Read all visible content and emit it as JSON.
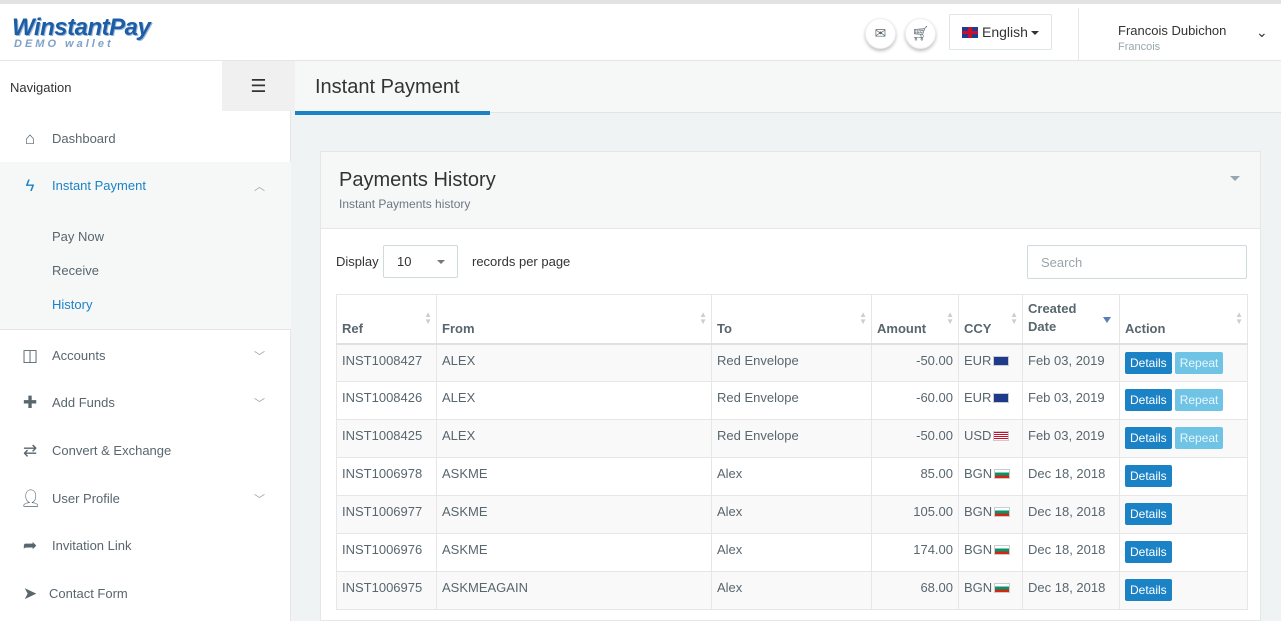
{
  "header": {
    "logo_main": "WinstantPay",
    "logo_sub": "DEMO wallet",
    "mail_icon": "envelope-icon",
    "cart_icon": "cart-icon",
    "language": "English",
    "user_name": "Francois Dubichon",
    "user_sub": "Francois"
  },
  "sidebar": {
    "heading": "Navigation",
    "items": [
      {
        "label": "Dashboard",
        "icon": "home-icon"
      },
      {
        "label": "Instant Payment",
        "icon": "bolt-icon"
      },
      {
        "label": "Accounts",
        "icon": "columns-icon"
      },
      {
        "label": "Add Funds",
        "icon": "plus-icon"
      },
      {
        "label": "Convert & Exchange",
        "icon": "exchange-icon"
      },
      {
        "label": "User Profile",
        "icon": "user-icon"
      },
      {
        "label": "Invitation Link",
        "icon": "share-icon"
      },
      {
        "label": "Contact Form",
        "icon": "paper-plane-icon"
      }
    ],
    "sub_items": [
      "Pay Now",
      "Receive",
      "History"
    ]
  },
  "page": {
    "title": "Instant Payment"
  },
  "panel": {
    "title": "Payments History",
    "subtitle": "Instant Payments history",
    "display_label": "Display",
    "display_value": "10",
    "records_label": "records per page",
    "search_placeholder": "Search"
  },
  "table": {
    "headers": [
      "Ref",
      "From",
      "To",
      "Amount",
      "CCY",
      "Created Date",
      "Action"
    ],
    "details_label": "Details",
    "repeat_label": "Repeat",
    "rows": [
      {
        "ref": "INST1008427",
        "from": "ALEX",
        "to": "Red Envelope",
        "amount": "-50.00",
        "ccy": "EUR",
        "date": "Feb 03, 2019"
      },
      {
        "ref": "INST1008426",
        "from": "ALEX",
        "to": "Red Envelope",
        "amount": "-60.00",
        "ccy": "EUR",
        "date": "Feb 03, 2019"
      },
      {
        "ref": "INST1008425",
        "from": "ALEX",
        "to": "Red Envelope",
        "amount": "-50.00",
        "ccy": "USD",
        "date": "Feb 03, 2019"
      },
      {
        "ref": "INST1006978",
        "from": "ASKME",
        "to": "Alex",
        "amount": "85.00",
        "ccy": "BGN",
        "date": "Dec 18, 2018"
      },
      {
        "ref": "INST1006977",
        "from": "ASKME",
        "to": "Alex",
        "amount": "105.00",
        "ccy": "BGN",
        "date": "Dec 18, 2018"
      },
      {
        "ref": "INST1006976",
        "from": "ASKME",
        "to": "Alex",
        "amount": "174.00",
        "ccy": "BGN",
        "date": "Dec 18, 2018"
      },
      {
        "ref": "INST1006975",
        "from": "ASKMEAGAIN",
        "to": "Alex",
        "amount": "68.00",
        "ccy": "BGN",
        "date": "Dec 18, 2018"
      }
    ]
  },
  "colors": {
    "accent": "#1c82c6",
    "repeat": "#6fc3e5"
  }
}
